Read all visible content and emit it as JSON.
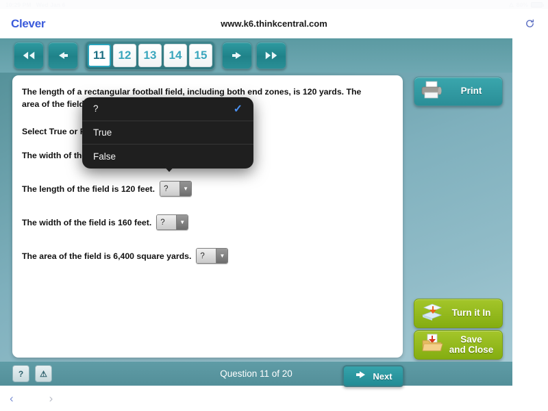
{
  "status_bar": {
    "time": "10:29 PM",
    "date": "Wed Jan 6",
    "wifi_icon": "wifi-icon",
    "battery_percent": "80%"
  },
  "browser": {
    "logo": "Clever",
    "url": "www.k6.thinkcentral.com",
    "reload_icon": "reload-icon",
    "back_chevron": "‹",
    "forward_chevron": "›"
  },
  "toolbar": {
    "first_label": "◀◀",
    "prev_label": "◀",
    "next_label": "▶",
    "last_label": "▶▶",
    "pages": [
      {
        "number": "11",
        "active": true
      },
      {
        "number": "12",
        "active": false
      },
      {
        "number": "13",
        "active": false
      },
      {
        "number": "14",
        "active": false
      },
      {
        "number": "15",
        "active": false
      }
    ]
  },
  "question": {
    "stem": "The length of a rectangular football field, including both end zones, is 120 yards. The area of the field is 57,600 square feet.",
    "instruction": "Select True or False for each statement.",
    "statements": [
      {
        "text": "The width of the field is 480 feet.",
        "value": "?"
      },
      {
        "text": "The length of the field is 120 feet.",
        "value": "?"
      },
      {
        "text": "The width of the field is 160 feet.",
        "value": "?"
      },
      {
        "text": "The area of the field is 6,400 square yards.",
        "value": "?"
      }
    ],
    "select_arrow": "▼"
  },
  "dropdown": {
    "options": [
      {
        "label": "?",
        "selected": true
      },
      {
        "label": "True",
        "selected": false
      },
      {
        "label": "False",
        "selected": false
      }
    ],
    "check_glyph": "✓"
  },
  "rail": {
    "print_label": "Print",
    "print_icon": "printer-icon",
    "turn_in_label": "Turn it In",
    "turn_in_icon": "turn-in-icon",
    "save_close_line1": "Save",
    "save_close_line2": "and Close",
    "save_close_icon": "save-folder-icon"
  },
  "footer": {
    "help_label": "?",
    "alert_label": "⚠",
    "counter": "Question 11 of 20",
    "next_label": "Next",
    "next_arrow_icon": "arrow-right-icon"
  },
  "colors": {
    "teal_accent": "#2a8e97",
    "green_accent": "#84ad11",
    "page_active": "#1d6f83",
    "clever_blue": "#3b5bdb"
  }
}
